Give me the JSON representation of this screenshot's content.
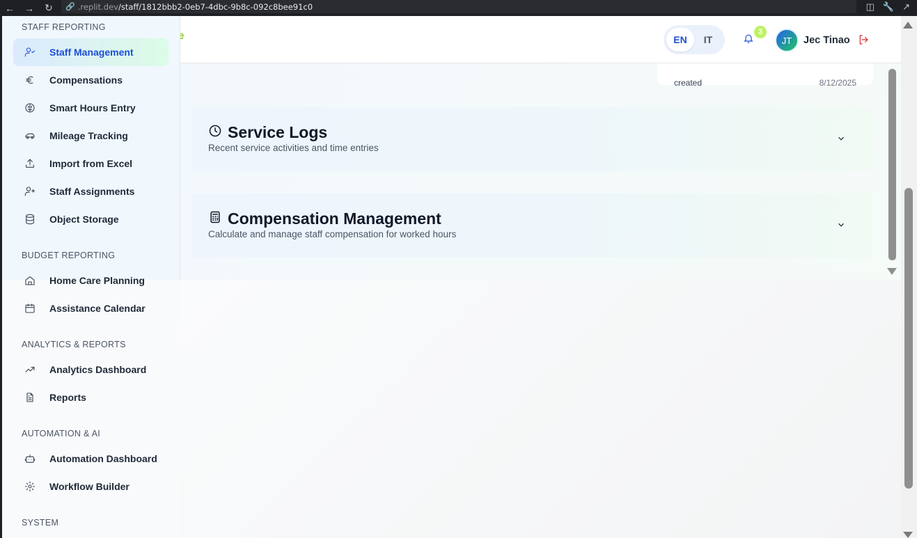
{
  "browser": {
    "url_host": ".replit.dev",
    "url_path": "/staff/1812bbb2-0eb7-4dbc-9b8c-092c8bee91c0"
  },
  "sidebar": {
    "sections": {
      "staff_reporting": "STAFF REPORTING",
      "budget_reporting": "BUDGET REPORTING",
      "analytics_reports": "ANALYTICS & REPORTS",
      "automation_ai": "AUTOMATION & AI",
      "system": "SYSTEM"
    },
    "items": [
      {
        "label": "Staff Management",
        "icon": "user-check-icon",
        "active": true
      },
      {
        "label": "Compensations",
        "icon": "euro-icon"
      },
      {
        "label": "Smart Hours Entry",
        "icon": "brain-icon"
      },
      {
        "label": "Mileage Tracking",
        "icon": "car-icon"
      },
      {
        "label": "Import from Excel",
        "icon": "upload-icon"
      },
      {
        "label": "Staff Assignments",
        "icon": "user-plus-icon"
      },
      {
        "label": "Object Storage",
        "icon": "database-icon"
      },
      {
        "label": "Home Care Planning",
        "icon": "home-icon"
      },
      {
        "label": "Assistance Calendar",
        "icon": "calendar-icon"
      },
      {
        "label": "Analytics Dashboard",
        "icon": "trending-up-icon"
      },
      {
        "label": "Reports",
        "icon": "file-text-icon"
      },
      {
        "label": "Automation Dashboard",
        "icon": "bot-icon"
      },
      {
        "label": "Workflow Builder",
        "icon": "settings-icon"
      }
    ]
  },
  "header": {
    "logo_fragment": "e",
    "lang_en": "EN",
    "lang_it": "IT",
    "notification_count": "3",
    "avatar_initials": "JT",
    "user_name": "Jec Tinao"
  },
  "info_card": {
    "label": "created",
    "value": "8/12/2025"
  },
  "sections": [
    {
      "title": "Service Logs",
      "subtitle": "Recent service activities and time entries",
      "icon": "clock-icon"
    },
    {
      "title": "Compensation Management",
      "subtitle": "Calculate and manage staff compensation for worked hours",
      "icon": "calculator-icon"
    }
  ],
  "colors": {
    "accent": "#1d4ed8",
    "brand_green": "#84cc16",
    "logout_red": "#dc2626"
  }
}
